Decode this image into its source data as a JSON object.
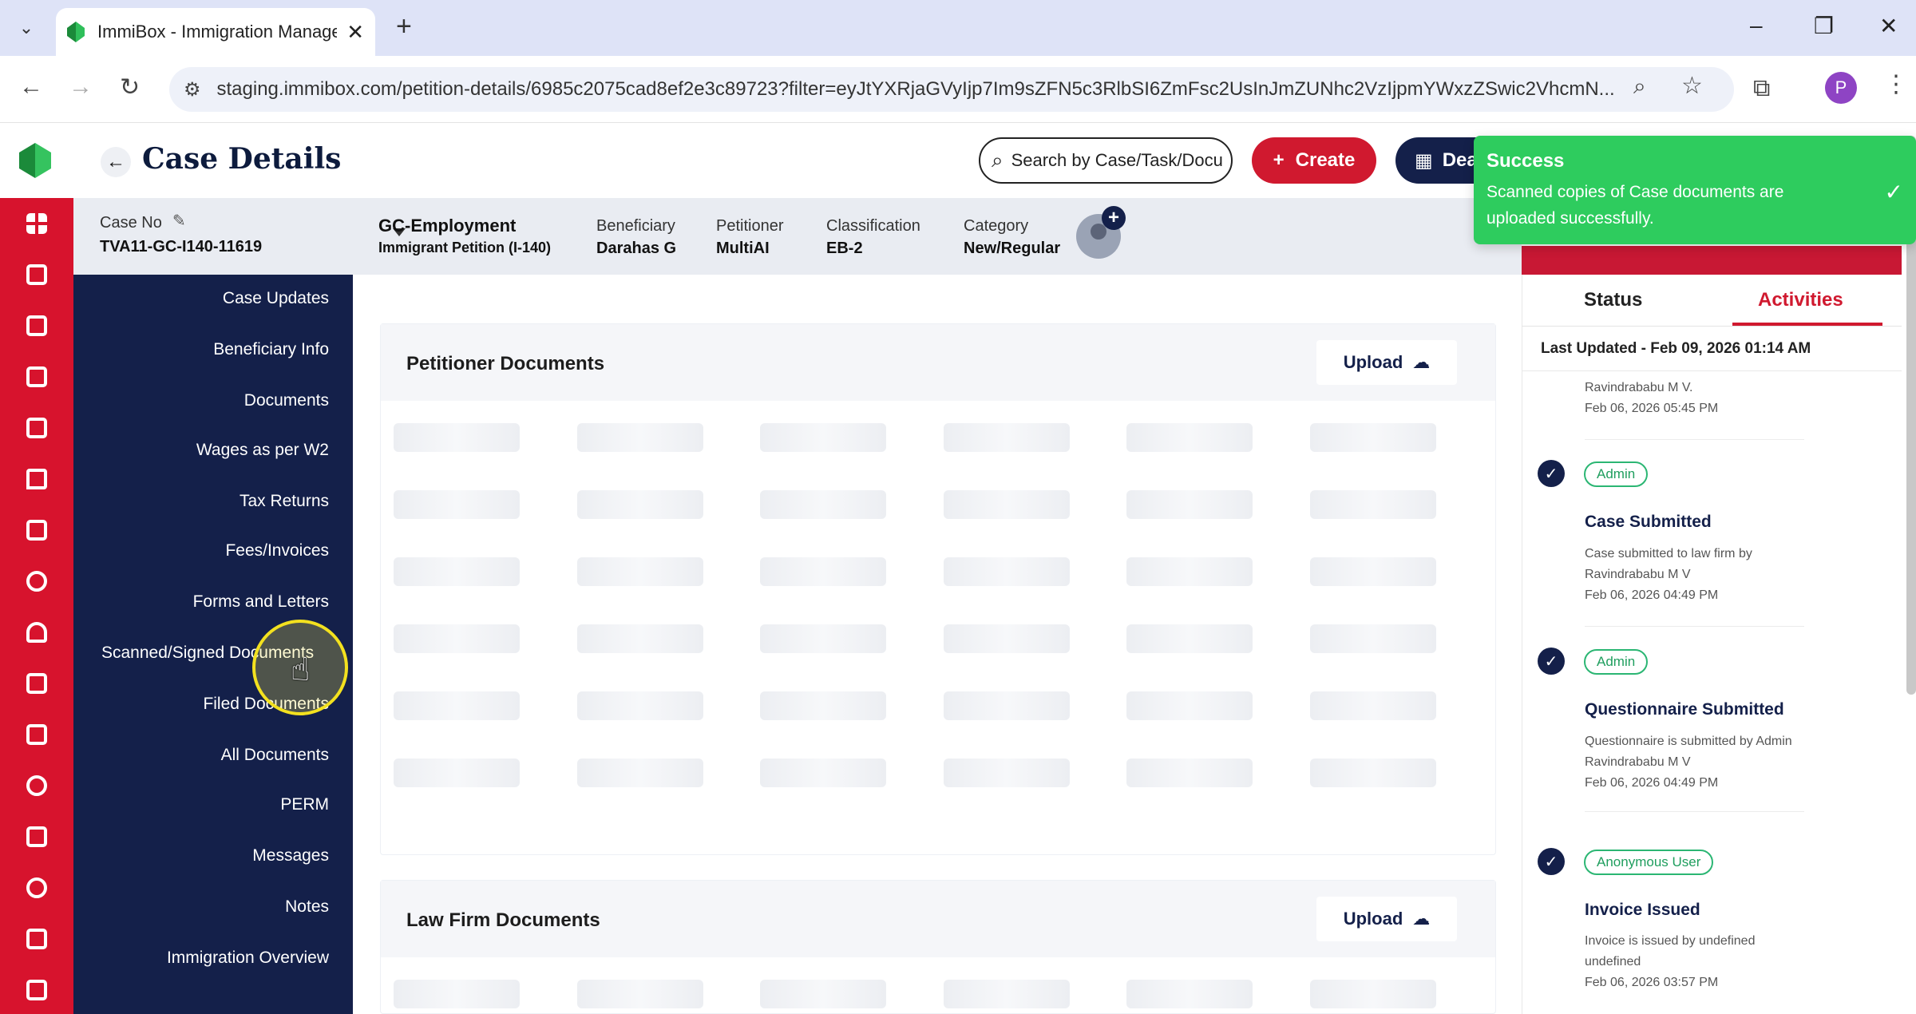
{
  "browser": {
    "tab_title": "ImmiBox - Immigration Manage",
    "url": "staging.immibox.com/petition-details/6985c2075cad8ef2e3c89723?filter=eyJtYXRjaGVyIjp7Im9sZFN5c3RlbSI6ZmFsc2UsInJmZUNhc2VzIjpmYWxzZSwic2VhcmN...",
    "profile_initial": "P",
    "icons": {
      "back": "arrow-left-icon",
      "forward": "arrow-right-icon",
      "reload": "reload-icon",
      "zoom": "zoom-icon",
      "bookmark": "star-icon",
      "extensions": "puzzle-icon",
      "menu": "kebab-icon"
    }
  },
  "header": {
    "title": "Case Details",
    "search_placeholder": "Search by Case/Task/Docu",
    "create_label": "Create",
    "deadline_label": "Dea"
  },
  "toast": {
    "title": "Success",
    "message": "Scanned copies of Case documents are uploaded successfully."
  },
  "case": {
    "case_no_label": "Case No",
    "case_no": "TVA11-GC-I140-11619",
    "type": "GC-Employment",
    "petition": "Immigrant Petition (I-140)",
    "beneficiary_label": "Beneficiary",
    "beneficiary": "Darahas G",
    "petitioner_label": "Petitioner",
    "petitioner": "MultiAI",
    "classification_label": "Classification",
    "classification": "EB-2",
    "category_label": "Category",
    "category": "New/Regular"
  },
  "sidenav": {
    "items": [
      {
        "label": "Case Updates"
      },
      {
        "label": "Beneficiary Info"
      },
      {
        "label": "Documents"
      },
      {
        "label": "Wages as per W2"
      },
      {
        "label": "Tax Returns"
      },
      {
        "label": "Fees/Invoices"
      },
      {
        "label": "Forms and Letters"
      },
      {
        "label": "Scanned/Signed Documents"
      },
      {
        "label": "Filed Documents"
      },
      {
        "label": "All Documents"
      },
      {
        "label": "PERM"
      },
      {
        "label": "Messages"
      },
      {
        "label": "Notes"
      },
      {
        "label": "Immigration Overview"
      }
    ],
    "active": "Scanned/Signed Documents"
  },
  "sections": [
    {
      "title": "Petitioner Documents",
      "upload_label": "Upload"
    },
    {
      "title": "Law Firm Documents",
      "upload_label": "Upload"
    }
  ],
  "right_panel": {
    "tabs": [
      {
        "label": "Status"
      },
      {
        "label": "Activities"
      }
    ],
    "active_tab": "Activities",
    "last_updated": "Last Updated - Feb 09, 2026 01:14 AM",
    "partial_entry": {
      "line1": "Ravindrababu M V.",
      "line2": "Feb 06, 2026 05:45 PM"
    },
    "activities": [
      {
        "badge": "Admin",
        "title": "Case Submitted",
        "line1": "Case submitted to law firm by",
        "line2": "Ravindrababu M V",
        "line3": "Feb 06, 2026 04:49 PM"
      },
      {
        "badge": "Admin",
        "title": "Questionnaire Submitted",
        "line1": "Questionnaire is submitted by Admin",
        "line2": "Ravindrababu M V",
        "line3": "Feb 06, 2026 04:49 PM"
      },
      {
        "badge": "Anonymous User",
        "title": "Invoice Issued",
        "line1": "Invoice is issued by undefined",
        "line2": "undefined",
        "line3": "Feb 06, 2026 03:57 PM"
      }
    ]
  },
  "colors": {
    "brand_red": "#d7132d",
    "navy": "#14204a",
    "success_green": "#2ecc5e"
  }
}
